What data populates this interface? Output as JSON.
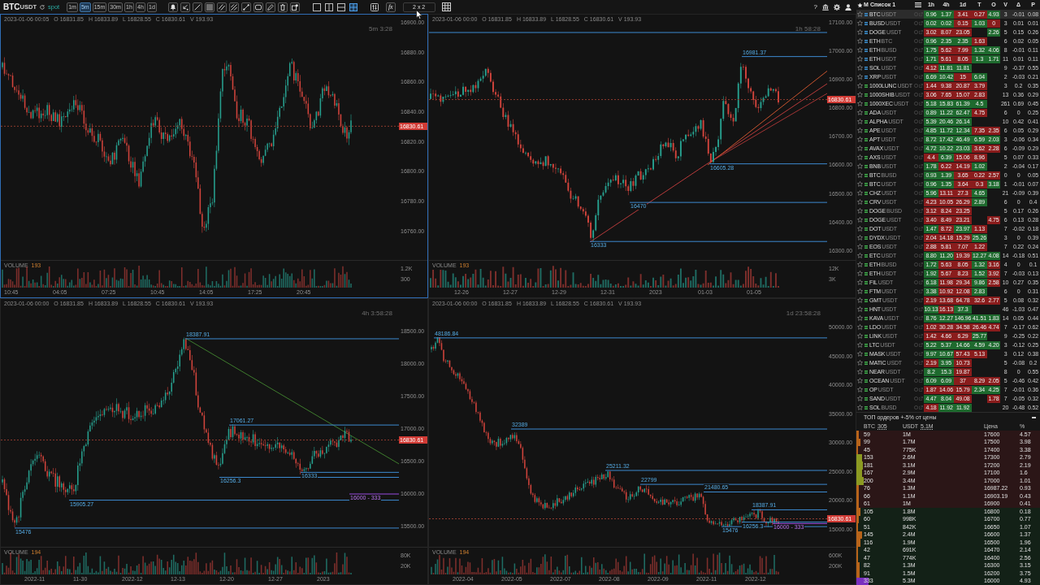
{
  "toolbar": {
    "symbol": "BTC",
    "quote": "USDT",
    "market": "spot",
    "timeframes": [
      {
        "label": "1m",
        "selected": false
      },
      {
        "label": "5m",
        "selected": true
      },
      {
        "label": "15m",
        "selected": false
      },
      {
        "label": "30m",
        "selected": false
      },
      {
        "label": "1h",
        "selected": false
      },
      {
        "label": "4h",
        "selected": false
      },
      {
        "label": "1d",
        "selected": false
      }
    ],
    "tools": [
      {
        "kind": "alert"
      },
      {
        "kind": "cursor"
      },
      {
        "kind": "ray"
      },
      {
        "kind": "rectangle"
      },
      {
        "kind": "channel"
      },
      {
        "kind": "hatch"
      },
      {
        "kind": "segment"
      },
      {
        "kind": "frame"
      },
      {
        "kind": "pencil"
      },
      {
        "kind": "trash"
      },
      {
        "kind": "camera"
      }
    ],
    "layouts": [
      {
        "kind": "single",
        "selected": false
      },
      {
        "kind": "columns",
        "selected": false
      },
      {
        "kind": "rows",
        "selected": false
      },
      {
        "kind": "grid",
        "selected": true
      }
    ],
    "formula": "fx",
    "layout_value": "2 x 2",
    "help": "?"
  },
  "charts": [
    {
      "selected": true,
      "ohlc": [
        "2023-01-06 00:05",
        "O 16831.85",
        "H 16833.89",
        "L 16828.55",
        "C 16830.61",
        "V 193.93"
      ],
      "countdown": "5m 3:28",
      "price_axis": [
        "16900.00",
        "16880.00",
        "16860.00",
        "16840.00",
        "16820.00",
        "16800.00",
        "16780.00",
        "16760.00"
      ],
      "last_price": "16830.61",
      "volume": {
        "label": "VOLUME",
        "value": "193",
        "axis": [
          "1.2K",
          "300"
        ]
      },
      "time_axis": [
        "10:45",
        "04:05",
        "07:25",
        "10:45",
        "14:05",
        "17:25",
        "20:45"
      ]
    },
    {
      "selected": false,
      "ohlc": [
        "2023-01-06 00:00",
        "O 16831.85",
        "H 16833.89",
        "L 16828.55",
        "C 16830.61",
        "V 193.93"
      ],
      "countdown": "1h 58:28",
      "price_axis": [
        "17100.00",
        "17000.00",
        "16900.00",
        "16800.00",
        "16700.00",
        "16600.00",
        "16500.00",
        "16400.00",
        "16300.00"
      ],
      "last_price": "16830.61",
      "levels": [
        {
          "kind": "level",
          "label": "16981.37"
        },
        {
          "kind": "level",
          "label": "16605.28"
        },
        {
          "kind": "level",
          "label": "16470"
        },
        {
          "kind": "level",
          "label": "16333"
        }
      ],
      "volume": {
        "label": "VOLUME",
        "value": "193",
        "axis": [
          "12K",
          "3K"
        ]
      },
      "time_axis": [
        "12-26",
        "12-27",
        "12-29",
        "12-31",
        "2023",
        "01-03",
        "01-05"
      ]
    },
    {
      "selected": false,
      "ohlc": [
        "2023-01-06 00:00",
        "O 16831.85",
        "H 16833.89",
        "L 16828.55",
        "C 16830.61",
        "V 193.93"
      ],
      "countdown": "4h 3:58:28",
      "price_axis": [
        "18500.00",
        "18000.00",
        "17500.00",
        "17000.00",
        "16500.00",
        "16000.00",
        "15500.00"
      ],
      "last_price": "16830.61",
      "levels": [
        {
          "kind": "level",
          "label": "18387.91"
        },
        {
          "kind": "level",
          "label": "17061.27"
        },
        {
          "kind": "level",
          "label": "16333"
        },
        {
          "kind": "level",
          "label": "16256.3"
        },
        {
          "kind": "level",
          "label": "15905.27"
        },
        {
          "kind": "order",
          "label": "16000 - 333"
        },
        {
          "kind": "level",
          "label": "15476"
        }
      ],
      "volume": {
        "label": "VOLUME",
        "value": "194",
        "axis": [
          "80K",
          "20K"
        ]
      },
      "time_axis": [
        "2022-11",
        "11-30",
        "2022-12",
        "12-13",
        "12-20",
        "12-27",
        "2023"
      ]
    },
    {
      "selected": false,
      "ohlc": [
        "2023-01-06 00:00",
        "O 16831.85",
        "H 16833.89",
        "L 16828.55",
        "C 16830.61",
        "V 193.93"
      ],
      "countdown": "1d 23:58:28",
      "price_axis": [
        "50000.00",
        "45000.00",
        "40000.00",
        "35000.00",
        "30000.00",
        "25000.00",
        "20000.00",
        "15000.00"
      ],
      "last_price": "16830.61",
      "levels": [
        {
          "kind": "level",
          "label": "48186.84"
        },
        {
          "kind": "level",
          "label": "32389"
        },
        {
          "kind": "level",
          "label": "25211.32"
        },
        {
          "kind": "level",
          "label": "22799"
        },
        {
          "kind": "level",
          "label": "21480.65"
        },
        {
          "kind": "level",
          "label": "18387.91"
        },
        {
          "kind": "level",
          "label": "16256.3"
        },
        {
          "kind": "order",
          "label": "16000 - 333"
        },
        {
          "kind": "level",
          "label": "15476"
        }
      ],
      "volume": {
        "label": "VOLUME",
        "value": "194",
        "axis": [
          "600K",
          "200K"
        ]
      },
      "time_axis": [
        "2022-04",
        "2022-05",
        "2022-07",
        "2022-08",
        "2022-09",
        "2022-11",
        "2022-12"
      ]
    }
  ],
  "watchlist": {
    "marker_header": "M",
    "title": "Список 1",
    "columns": [
      "1h",
      "4h",
      "1d",
      "T",
      "O",
      "V",
      "Δ",
      "P"
    ],
    "rows": [
      {
        "symbol": "BTC",
        "quote": "USDT",
        "color": "#3b8fd0",
        "starred": false,
        "selected": true,
        "cells": [
          {
            "text": "0.96",
            "color": "#1e6a2e"
          },
          {
            "text": "1.37",
            "color": "#1e6a2e"
          },
          {
            "text": "3.41",
            "color": "#8a1c1c"
          },
          {
            "text": "0.27",
            "color": "#8a1c1c"
          },
          {
            "text": "4.93",
            "color": "#1e6a2e"
          }
        ],
        "v": "3",
        "delta": "-0.01",
        "p": "0.08"
      },
      {
        "symbol": "BUSD",
        "quote": "USDT",
        "color": "#3b8fd0",
        "starred": false,
        "selected": false,
        "cells": [
          {
            "text": "0.02",
            "color": "#1e6a2e"
          },
          {
            "text": "0.02",
            "color": "#1e6a2e"
          },
          {
            "text": "0.15",
            "color": "#8a1c1c"
          },
          {
            "text": "1.03",
            "color": "#1e6a2e"
          },
          {
            "text": "0",
            "color": "#8a1c1c"
          }
        ],
        "v": "3",
        "delta": "0.01",
        "p": "0.01"
      },
      {
        "symbol": "DOGE",
        "quote": "USDT",
        "color": "#3b8fd0",
        "starred": false,
        "selected": false,
        "cells": [
          {
            "text": "3.02",
            "color": "#8a1c1c"
          },
          {
            "text": "8.07",
            "color": "#8a1c1c"
          },
          {
            "text": "23.05",
            "color": "#8a1c1c"
          },
          null,
          {
            "text": "2.26",
            "color": "#1e6a2e"
          }
        ],
        "v": "5",
        "delta": "0.15",
        "p": "0.26"
      },
      {
        "symbol": "ETH",
        "quote": "BTC",
        "color": "#3b8fd0",
        "starred": false,
        "selected": false,
        "cells": [
          {
            "text": "0.96",
            "color": "#1e6a2e"
          },
          {
            "text": "2.35",
            "color": "#1e6a2e"
          },
          {
            "text": "2.35",
            "color": "#1e6a2e"
          },
          {
            "text": "1.63",
            "color": "#8a1c1c"
          },
          null
        ],
        "v": "6",
        "delta": "0.02",
        "p": "0.05"
      },
      {
        "symbol": "ETH",
        "quote": "BUSD",
        "color": "#3b8fd0",
        "starred": false,
        "selected": false,
        "cells": [
          {
            "text": "1.75",
            "color": "#1e6a2e"
          },
          {
            "text": "5.62",
            "color": "#8a1c1c"
          },
          {
            "text": "7.99",
            "color": "#8a1c1c"
          },
          {
            "text": "1.32",
            "color": "#1e6a2e"
          },
          {
            "text": "4.06",
            "color": "#1e6a2e"
          }
        ],
        "v": "8",
        "delta": "-0.01",
        "p": "0.11"
      },
      {
        "symbol": "ETH",
        "quote": "USDT",
        "color": "#3b8fd0",
        "starred": false,
        "selected": false,
        "cells": [
          {
            "text": "1.71",
            "color": "#1e6a2e"
          },
          {
            "text": "5.61",
            "color": "#8a1c1c"
          },
          {
            "text": "8.05",
            "color": "#8a1c1c"
          },
          {
            "text": "1.3",
            "color": "#1e6a2e"
          },
          {
            "text": "1.71",
            "color": "#1e6a2e"
          }
        ],
        "v": "11",
        "delta": "0.01",
        "p": "0.11"
      },
      {
        "symbol": "SOL",
        "quote": "USDT",
        "color": "#3b8fd0",
        "starred": false,
        "selected": false,
        "cells": [
          {
            "text": "4.12",
            "color": "#8a1c1c"
          },
          {
            "text": "11.81",
            "color": "#1e6a2e"
          },
          {
            "text": "11.81",
            "color": "#1e6a2e"
          },
          null,
          null
        ],
        "v": "9",
        "delta": "-0.37",
        "p": "0.55"
      },
      {
        "symbol": "XRP",
        "quote": "USDT",
        "color": "#3b8fd0",
        "starred": false,
        "selected": false,
        "cells": [
          {
            "text": "6.69",
            "color": "#1e6a2e"
          },
          {
            "text": "10.42",
            "color": "#1e6a2e"
          },
          {
            "text": "15",
            "color": "#8a1c1c"
          },
          {
            "text": "6.04",
            "color": "#1e6a2e"
          },
          null
        ],
        "v": "2",
        "delta": "-0.03",
        "p": "0.21"
      },
      {
        "symbol": "1000LUNC",
        "quote": "USDT",
        "color": "#3fae4a",
        "starred": false,
        "selected": false,
        "cells": [
          {
            "text": "1.44",
            "color": "#8a1c1c"
          },
          {
            "text": "9.38",
            "color": "#8a1c1c"
          },
          {
            "text": "20.87",
            "color": "#8a1c1c"
          },
          {
            "text": "3.79",
            "color": "#8a1c1c"
          },
          null
        ],
        "v": "3",
        "delta": "0.2",
        "p": "0.35"
      },
      {
        "symbol": "1000SHIB",
        "quote": "USDT",
        "color": "#3fae4a",
        "starred": false,
        "selected": false,
        "cells": [
          {
            "text": "3.06",
            "color": "#8a1c1c"
          },
          {
            "text": "7.65",
            "color": "#8a1c1c"
          },
          {
            "text": "15.07",
            "color": "#8a1c1c"
          },
          {
            "text": "2.83",
            "color": "#8a1c1c"
          },
          null
        ],
        "v": "13",
        "delta": "0.36",
        "p": "0.29"
      },
      {
        "symbol": "1000XEC",
        "quote": "USDT",
        "color": "#3fae4a",
        "starred": false,
        "selected": false,
        "cells": [
          {
            "text": "5.18",
            "color": "#1e6a2e"
          },
          {
            "text": "15.83",
            "color": "#1e6a2e"
          },
          {
            "text": "61.39",
            "color": "#1e6a2e"
          },
          {
            "text": "4.5",
            "color": "#1e6a2e"
          },
          null
        ],
        "v": "261",
        "delta": "0.69",
        "p": "0.45"
      },
      {
        "symbol": "ADA",
        "quote": "USDT",
        "color": "#3fae4a",
        "starred": false,
        "selected": false,
        "cells": [
          {
            "text": "0.89",
            "color": "#1e6a2e"
          },
          {
            "text": "11.22",
            "color": "#1e6a2e"
          },
          {
            "text": "62.47",
            "color": "#1e6a2e"
          },
          {
            "text": "4.75",
            "color": "#8a1c1c"
          },
          null
        ],
        "v": "6",
        "delta": "0",
        "p": "0.25"
      },
      {
        "symbol": "ALPHA",
        "quote": "USDT",
        "color": "#3fae4a",
        "starred": false,
        "selected": false,
        "cells": [
          {
            "text": "5.39",
            "color": "#1e6a2e"
          },
          {
            "text": "20.46",
            "color": "#1e6a2e"
          },
          {
            "text": "26.14",
            "color": "#1e6a2e"
          },
          null,
          null
        ],
        "v": "10",
        "delta": "0.42",
        "p": "0.41"
      },
      {
        "symbol": "APE",
        "quote": "USDT",
        "color": "#3fae4a",
        "starred": false,
        "selected": false,
        "cells": [
          {
            "text": "4.85",
            "color": "#1e6a2e"
          },
          {
            "text": "11.72",
            "color": "#1e6a2e"
          },
          {
            "text": "12.34",
            "color": "#1e6a2e"
          },
          {
            "text": "7.35",
            "color": "#8a1c1c"
          },
          {
            "text": "2.35",
            "color": "#8a1c1c"
          }
        ],
        "v": "6",
        "delta": "0.05",
        "p": "0.29"
      },
      {
        "symbol": "APT",
        "quote": "USDT",
        "color": "#3fae4a",
        "starred": false,
        "selected": false,
        "cells": [
          {
            "text": "8.72",
            "color": "#1e6a2e"
          },
          {
            "text": "17.42",
            "color": "#1e6a2e"
          },
          {
            "text": "46.49",
            "color": "#1e6a2e"
          },
          {
            "text": "6.59",
            "color": "#1e6a2e"
          },
          {
            "text": "2.03",
            "color": "#1e6a2e"
          }
        ],
        "v": "3",
        "delta": "-0.06",
        "p": "0.34"
      },
      {
        "symbol": "AVAX",
        "quote": "USDT",
        "color": "#3fae4a",
        "starred": false,
        "selected": false,
        "cells": [
          {
            "text": "4.72",
            "color": "#1e6a2e"
          },
          {
            "text": "10.22",
            "color": "#1e6a2e"
          },
          {
            "text": "23.03",
            "color": "#1e6a2e"
          },
          {
            "text": "3.62",
            "color": "#8a1c1c"
          },
          {
            "text": "2.28",
            "color": "#8a1c1c"
          }
        ],
        "v": "6",
        "delta": "-0.09",
        "p": "0.29"
      },
      {
        "symbol": "AXS",
        "quote": "USDT",
        "color": "#3fae4a",
        "starred": false,
        "selected": false,
        "cells": [
          {
            "text": "4.4",
            "color": "#8a1c1c"
          },
          {
            "text": "6.39",
            "color": "#1e6a2e"
          },
          {
            "text": "15.06",
            "color": "#8a1c1c"
          },
          {
            "text": "8.96",
            "color": "#8a1c1c"
          },
          null
        ],
        "v": "5",
        "delta": "0.07",
        "p": "0.33"
      },
      {
        "symbol": "BNB",
        "quote": "USDT",
        "color": "#3fae4a",
        "starred": false,
        "selected": false,
        "cells": [
          {
            "text": "1.78",
            "color": "#1e6a2e"
          },
          {
            "text": "6.22",
            "color": "#8a1c1c"
          },
          {
            "text": "14.19",
            "color": "#8a1c1c"
          },
          {
            "text": "1.02",
            "color": "#1e6a2e"
          },
          null
        ],
        "v": "2",
        "delta": "-0.04",
        "p": "0.17"
      },
      {
        "symbol": "BTC",
        "quote": "BUSD",
        "color": "#3fae4a",
        "starred": false,
        "selected": false,
        "cells": [
          {
            "text": "0.93",
            "color": "#1e6a2e"
          },
          {
            "text": "1.39",
            "color": "#1e6a2e"
          },
          {
            "text": "3.65",
            "color": "#8a1c1c"
          },
          {
            "text": "0.22",
            "color": "#8a1c1c"
          },
          {
            "text": "2.57",
            "color": "#8a1c1c"
          }
        ],
        "v": "0",
        "delta": "0",
        "p": "0.05"
      },
      {
        "symbol": "BTC",
        "quote": "USDT",
        "color": "#3fae4a",
        "starred": false,
        "selected": false,
        "cells": [
          {
            "text": "0.96",
            "color": "#1e6a2e"
          },
          {
            "text": "1.35",
            "color": "#1e6a2e"
          },
          {
            "text": "3.64",
            "color": "#8a1c1c"
          },
          {
            "text": "0.3",
            "color": "#8a1c1c"
          },
          {
            "text": "3.18",
            "color": "#1e6a2e"
          }
        ],
        "v": "1",
        "delta": "-0.01",
        "p": "0.07"
      },
      {
        "symbol": "CHZ",
        "quote": "USDT",
        "color": "#3fae4a",
        "starred": false,
        "selected": false,
        "cells": [
          {
            "text": "5.96",
            "color": "#1e6a2e"
          },
          {
            "text": "13.11",
            "color": "#8a1c1c"
          },
          {
            "text": "27.3",
            "color": "#8a1c1c"
          },
          {
            "text": "4.65",
            "color": "#1e6a2e"
          },
          null
        ],
        "v": "21",
        "delta": "-0.09",
        "p": "0.39"
      },
      {
        "symbol": "CRV",
        "quote": "USDT",
        "color": "#3fae4a",
        "starred": false,
        "selected": false,
        "cells": [
          {
            "text": "4.23",
            "color": "#8a1c1c"
          },
          {
            "text": "10.05",
            "color": "#8a1c1c"
          },
          {
            "text": "26.29",
            "color": "#8a1c1c"
          },
          {
            "text": "2.89",
            "color": "#1e6a2e"
          },
          null
        ],
        "v": "6",
        "delta": "0",
        "p": "0.4"
      },
      {
        "symbol": "DOGE",
        "quote": "BUSD",
        "color": "#3fae4a",
        "starred": false,
        "selected": false,
        "cells": [
          {
            "text": "3.12",
            "color": "#8a1c1c"
          },
          {
            "text": "8.24",
            "color": "#8a1c1c"
          },
          {
            "text": "23.25",
            "color": "#8a1c1c"
          },
          null,
          null
        ],
        "v": "5",
        "delta": "0.17",
        "p": "0.26"
      },
      {
        "symbol": "DOGE",
        "quote": "USDT",
        "color": "#3fae4a",
        "starred": false,
        "selected": false,
        "cells": [
          {
            "text": "3.40",
            "color": "#8a1c1c"
          },
          {
            "text": "8.49",
            "color": "#8a1c1c"
          },
          {
            "text": "23.21",
            "color": "#8a1c1c"
          },
          null,
          {
            "text": "4.75",
            "color": "#8a1c1c"
          }
        ],
        "v": "6",
        "delta": "0.13",
        "p": "0.28"
      },
      {
        "symbol": "DOT",
        "quote": "USDT",
        "color": "#3fae4a",
        "starred": false,
        "selected": false,
        "cells": [
          {
            "text": "1.47",
            "color": "#1e6a2e"
          },
          {
            "text": "8.72",
            "color": "#8a1c1c"
          },
          {
            "text": "23.97",
            "color": "#1e6a2e"
          },
          {
            "text": "1.13",
            "color": "#8a1c1c"
          },
          null
        ],
        "v": "7",
        "delta": "-0.02",
        "p": "0.18"
      },
      {
        "symbol": "DYDX",
        "quote": "USDT",
        "color": "#3fae4a",
        "starred": false,
        "selected": false,
        "cells": [
          {
            "text": "2.04",
            "color": "#8a1c1c"
          },
          {
            "text": "14.18",
            "color": "#8a1c1c"
          },
          {
            "text": "15.29",
            "color": "#8a1c1c"
          },
          {
            "text": "25.26",
            "color": "#1e6a2e"
          },
          null
        ],
        "v": "3",
        "delta": "0",
        "p": "0.39"
      },
      {
        "symbol": "EOS",
        "quote": "USDT",
        "color": "#3fae4a",
        "starred": false,
        "selected": false,
        "cells": [
          {
            "text": "2.88",
            "color": "#8a1c1c"
          },
          {
            "text": "5.81",
            "color": "#8a1c1c"
          },
          {
            "text": "7.07",
            "color": "#8a1c1c"
          },
          {
            "text": "1.22",
            "color": "#8a1c1c"
          },
          null
        ],
        "v": "7",
        "delta": "0.22",
        "p": "0.24"
      },
      {
        "symbol": "ETC",
        "quote": "USDT",
        "color": "#3fae4a",
        "starred": false,
        "selected": false,
        "cells": [
          {
            "text": "8.80",
            "color": "#1e6a2e"
          },
          {
            "text": "11.20",
            "color": "#1e6a2e"
          },
          {
            "text": "19.39",
            "color": "#8a1c1c"
          },
          {
            "text": "12.27",
            "color": "#1e6a2e"
          },
          {
            "text": "4.08",
            "color": "#1e6a2e"
          }
        ],
        "v": "14",
        "delta": "-0.18",
        "p": "0.51"
      },
      {
        "symbol": "ETH",
        "quote": "BUSD",
        "color": "#3fae4a",
        "starred": false,
        "selected": false,
        "cells": [
          {
            "text": "1.72",
            "color": "#1e6a2e"
          },
          {
            "text": "5.63",
            "color": "#8a1c1c"
          },
          {
            "text": "8.05",
            "color": "#8a1c1c"
          },
          {
            "text": "1.32",
            "color": "#1e6a2e"
          },
          {
            "text": "3.16",
            "color": "#8a1c1c"
          }
        ],
        "v": "4",
        "delta": "0",
        "p": "0.1"
      },
      {
        "symbol": "ETH",
        "quote": "USDT",
        "color": "#3fae4a",
        "starred": false,
        "selected": false,
        "cells": [
          {
            "text": "1.92",
            "color": "#1e6a2e"
          },
          {
            "text": "5.67",
            "color": "#8a1c1c"
          },
          {
            "text": "8.23",
            "color": "#8a1c1c"
          },
          {
            "text": "1.52",
            "color": "#1e6a2e"
          },
          {
            "text": "3.92",
            "color": "#8a1c1c"
          }
        ],
        "v": "7",
        "delta": "-0.03",
        "p": "0.13"
      },
      {
        "symbol": "FIL",
        "quote": "USDT",
        "color": "#3fae4a",
        "starred": false,
        "selected": false,
        "cells": [
          {
            "text": "6.18",
            "color": "#1e6a2e"
          },
          {
            "text": "11.98",
            "color": "#8a1c1c"
          },
          {
            "text": "29.34",
            "color": "#8a1c1c"
          },
          {
            "text": "9.86",
            "color": "#1e6a2e"
          },
          {
            "text": "2.58",
            "color": "#8a1c1c"
          }
        ],
        "v": "10",
        "delta": "0.27",
        "p": "0.35"
      },
      {
        "symbol": "FTM",
        "quote": "USDT",
        "color": "#3fae4a",
        "starred": false,
        "selected": false,
        "cells": [
          {
            "text": "3.38",
            "color": "#1e6a2e"
          },
          {
            "text": "10.92",
            "color": "#8a1c1c"
          },
          {
            "text": "12.08",
            "color": "#8a1c1c"
          },
          {
            "text": "2.83",
            "color": "#1e6a2e"
          },
          null
        ],
        "v": "6",
        "delta": "0",
        "p": "0.31"
      },
      {
        "symbol": "GMT",
        "quote": "USDT",
        "color": "#3fae4a",
        "starred": false,
        "selected": false,
        "cells": [
          {
            "text": "2.19",
            "color": "#8a1c1c"
          },
          {
            "text": "13.68",
            "color": "#8a1c1c"
          },
          {
            "text": "64.78",
            "color": "#8a1c1c"
          },
          {
            "text": "32.6",
            "color": "#8a1c1c"
          },
          {
            "text": "2.77",
            "color": "#8a1c1c"
          }
        ],
        "v": "5",
        "delta": "0.08",
        "p": "0.32"
      },
      {
        "symbol": "HNT",
        "quote": "USDT",
        "color": "#3fae4a",
        "starred": false,
        "selected": false,
        "cells": [
          {
            "text": "10.13",
            "color": "#1e6a2e"
          },
          {
            "text": "16.13",
            "color": "#8a1c1c"
          },
          {
            "text": "37.3",
            "color": "#1e6a2e"
          },
          null,
          null
        ],
        "v": "46",
        "delta": "-1.03",
        "p": "0.47"
      },
      {
        "symbol": "KAVA",
        "quote": "USDT",
        "color": "#3fae4a",
        "starred": false,
        "selected": false,
        "cells": [
          {
            "text": "8.76",
            "color": "#1e6a2e"
          },
          {
            "text": "12.27",
            "color": "#1e6a2e"
          },
          {
            "text": "146.96",
            "color": "#1e6a2e"
          },
          {
            "text": "41.51",
            "color": "#1e6a2e"
          },
          {
            "text": "1.83",
            "color": "#1e6a2e"
          }
        ],
        "v": "14",
        "delta": "0.05",
        "p": "0.44"
      },
      {
        "symbol": "LDO",
        "quote": "USDT",
        "color": "#3fae4a",
        "starred": false,
        "selected": false,
        "cells": [
          {
            "text": "1.02",
            "color": "#8a1c1c"
          },
          {
            "text": "30.28",
            "color": "#8a1c1c"
          },
          {
            "text": "34.58",
            "color": "#8a1c1c"
          },
          {
            "text": "26.46",
            "color": "#8a1c1c"
          },
          {
            "text": "4.74",
            "color": "#8a1c1c"
          }
        ],
        "v": "7",
        "delta": "-0.17",
        "p": "0.62"
      },
      {
        "symbol": "LINK",
        "quote": "USDT",
        "color": "#3fae4a",
        "starred": false,
        "selected": false,
        "cells": [
          {
            "text": "1.42",
            "color": "#8a1c1c"
          },
          {
            "text": "4.66",
            "color": "#8a1c1c"
          },
          {
            "text": "6.29",
            "color": "#8a1c1c"
          },
          {
            "text": "25.77",
            "color": "#1e6a2e"
          },
          null
        ],
        "v": "9",
        "delta": "-0.25",
        "p": "0.22"
      },
      {
        "symbol": "LTC",
        "quote": "USDT",
        "color": "#3fae4a",
        "starred": false,
        "selected": false,
        "cells": [
          {
            "text": "5.22",
            "color": "#1e6a2e"
          },
          {
            "text": "5.37",
            "color": "#1e6a2e"
          },
          {
            "text": "14.66",
            "color": "#1e6a2e"
          },
          {
            "text": "4.59",
            "color": "#1e6a2e"
          },
          {
            "text": "4.20",
            "color": "#1e6a2e"
          }
        ],
        "v": "3",
        "delta": "-0.12",
        "p": "0.25"
      },
      {
        "symbol": "MASK",
        "quote": "USDT",
        "color": "#3fae4a",
        "starred": false,
        "selected": false,
        "cells": [
          {
            "text": "9.97",
            "color": "#1e6a2e"
          },
          {
            "text": "10.67",
            "color": "#1e6a2e"
          },
          {
            "text": "57.43",
            "color": "#8a1c1c"
          },
          {
            "text": "5.13",
            "color": "#8a1c1c"
          },
          null
        ],
        "v": "3",
        "delta": "0.12",
        "p": "0.38"
      },
      {
        "symbol": "MATIC",
        "quote": "USDT",
        "color": "#3fae4a",
        "starred": false,
        "selected": false,
        "cells": [
          {
            "text": "2.19",
            "color": "#8a1c1c"
          },
          {
            "text": "3.95",
            "color": "#1e6a2e"
          },
          {
            "text": "10.73",
            "color": "#8a1c1c"
          },
          null,
          null
        ],
        "v": "5",
        "delta": "-0.08",
        "p": "0.2"
      },
      {
        "symbol": "NEAR",
        "quote": "USDT",
        "color": "#3fae4a",
        "starred": false,
        "selected": false,
        "cells": [
          {
            "text": "8.2",
            "color": "#1e6a2e"
          },
          {
            "text": "15.3",
            "color": "#1e6a2e"
          },
          {
            "text": "19.87",
            "color": "#8a1c1c"
          },
          null,
          null
        ],
        "v": "8",
        "delta": "0",
        "p": "0.55"
      },
      {
        "symbol": "OCEAN",
        "quote": "USDT",
        "color": "#3fae4a",
        "starred": false,
        "selected": false,
        "cells": [
          {
            "text": "6.09",
            "color": "#1e6a2e"
          },
          {
            "text": "6.09",
            "color": "#1e6a2e"
          },
          {
            "text": "37",
            "color": "#8a1c1c"
          },
          {
            "text": "8.29",
            "color": "#8a1c1c"
          },
          {
            "text": "2.05",
            "color": "#8a1c1c"
          }
        ],
        "v": "5",
        "delta": "-0.46",
        "p": "0.42"
      },
      {
        "symbol": "OP",
        "quote": "USDT",
        "color": "#3fae4a",
        "starred": false,
        "selected": false,
        "cells": [
          {
            "text": "1.87",
            "color": "#8a1c1c"
          },
          {
            "text": "14.06",
            "color": "#8a1c1c"
          },
          {
            "text": "15.79",
            "color": "#8a1c1c"
          },
          {
            "text": "2.34",
            "color": "#1e6a2e"
          },
          {
            "text": "4.25",
            "color": "#1e6a2e"
          }
        ],
        "v": "7",
        "delta": "-0.01",
        "p": "0.36"
      },
      {
        "symbol": "SAND",
        "quote": "USDT",
        "color": "#3fae4a",
        "starred": false,
        "selected": false,
        "cells": [
          {
            "text": "4.47",
            "color": "#1e6a2e"
          },
          {
            "text": "8.04",
            "color": "#1e6a2e"
          },
          {
            "text": "49.08",
            "color": "#8a1c1c"
          },
          null,
          {
            "text": "1.78",
            "color": "#8a1c1c"
          }
        ],
        "v": "7",
        "delta": "-0.05",
        "p": "0.32"
      },
      {
        "symbol": "SOL",
        "quote": "BUSD",
        "color": "#3fae4a",
        "starred": false,
        "selected": false,
        "cells": [
          {
            "text": "4.18",
            "color": "#8a1c1c"
          },
          {
            "text": "11.92",
            "color": "#1e6a2e"
          },
          {
            "text": "11.92",
            "color": "#1e6a2e"
          },
          null,
          null
        ],
        "v": "20",
        "delta": "-0.48",
        "p": "0.52"
      }
    ]
  },
  "orderbook": {
    "title": "ТОП ордеров +-5% от цены",
    "columns": [
      {
        "label": "BTC",
        "total": "305"
      },
      {
        "label": "USDT",
        "total": "5.1M"
      },
      {
        "label": "Цена"
      },
      {
        "label": "%"
      }
    ],
    "rows": [
      {
        "kind": "ask",
        "amount": "59",
        "value": "1M",
        "price": "17600",
        "percent": "4.57",
        "level": 0.012,
        "color": "#b8641a"
      },
      {
        "kind": "ask",
        "amount": "99",
        "value": "1.7M",
        "price": "17500",
        "percent": "3.98",
        "level": 0.02,
        "color": "#b8641a"
      },
      {
        "kind": "ask",
        "amount": "45",
        "value": "775K",
        "price": "17400",
        "percent": "3.38",
        "level": 0.009,
        "color": "#b8641a"
      },
      {
        "kind": "ask",
        "amount": "153",
        "value": "2.6M",
        "price": "17300",
        "percent": "2.79",
        "level": 0.031,
        "color": "#8c9a22"
      },
      {
        "kind": "ask",
        "amount": "181",
        "value": "3.1M",
        "price": "17200",
        "percent": "2.19",
        "level": 0.036,
        "color": "#8c9a22"
      },
      {
        "kind": "ask",
        "amount": "167",
        "value": "2.9M",
        "price": "17100",
        "percent": "1.6",
        "level": 0.033,
        "color": "#8c9a22"
      },
      {
        "kind": "ask",
        "amount": "200",
        "value": "3.4M",
        "price": "17000",
        "percent": "1.01",
        "level": 0.04,
        "color": "#8c9a22"
      },
      {
        "kind": "ask",
        "amount": "76",
        "value": "1.3M",
        "price": "16987.22",
        "percent": "0.93",
        "level": 0.015,
        "color": "#b8641a"
      },
      {
        "kind": "ask",
        "amount": "66",
        "value": "1.1M",
        "price": "16903.19",
        "percent": "0.43",
        "level": 0.013,
        "color": "#b8641a"
      },
      {
        "kind": "ask",
        "amount": "61",
        "value": "1M",
        "price": "16900",
        "percent": "0.41",
        "level": 0.012,
        "color": "#b8641a"
      },
      {
        "kind": "bid",
        "amount": "105",
        "value": "1.8M",
        "price": "16800",
        "percent": "0.18",
        "level": 0.021,
        "color": "#b8641a"
      },
      {
        "kind": "bid",
        "amount": "60",
        "value": "998K",
        "price": "16700",
        "percent": "0.77",
        "level": 0.012,
        "color": "#b8641a"
      },
      {
        "kind": "bid",
        "amount": "51",
        "value": "842K",
        "price": "16650",
        "percent": "1.07",
        "level": 0.01,
        "color": "#b8641a"
      },
      {
        "kind": "bid",
        "amount": "145",
        "value": "2.4M",
        "price": "16600",
        "percent": "1.37",
        "level": 0.029,
        "color": "#b8641a"
      },
      {
        "kind": "bid",
        "amount": "116",
        "value": "1.9M",
        "price": "16500",
        "percent": "1.96",
        "level": 0.023,
        "color": "#b8641a"
      },
      {
        "kind": "bid",
        "amount": "42",
        "value": "691K",
        "price": "16470",
        "percent": "2.14",
        "level": 0.008,
        "color": "#b8641a"
      },
      {
        "kind": "bid",
        "amount": "47",
        "value": "774K",
        "price": "16400",
        "percent": "2.56",
        "level": 0.009,
        "color": "#b8641a"
      },
      {
        "kind": "bid",
        "amount": "82",
        "value": "1.3M",
        "price": "16300",
        "percent": "3.15",
        "level": 0.016,
        "color": "#b8641a"
      },
      {
        "kind": "bid",
        "amount": "91",
        "value": "1.5M",
        "price": "16200",
        "percent": "3.75",
        "level": 0.018,
        "color": "#b8641a"
      },
      {
        "kind": "bid",
        "amount": "333",
        "value": "5.3M",
        "price": "16000",
        "percent": "4.93",
        "level": 0.066,
        "color": "#7a2fc0"
      }
    ]
  }
}
